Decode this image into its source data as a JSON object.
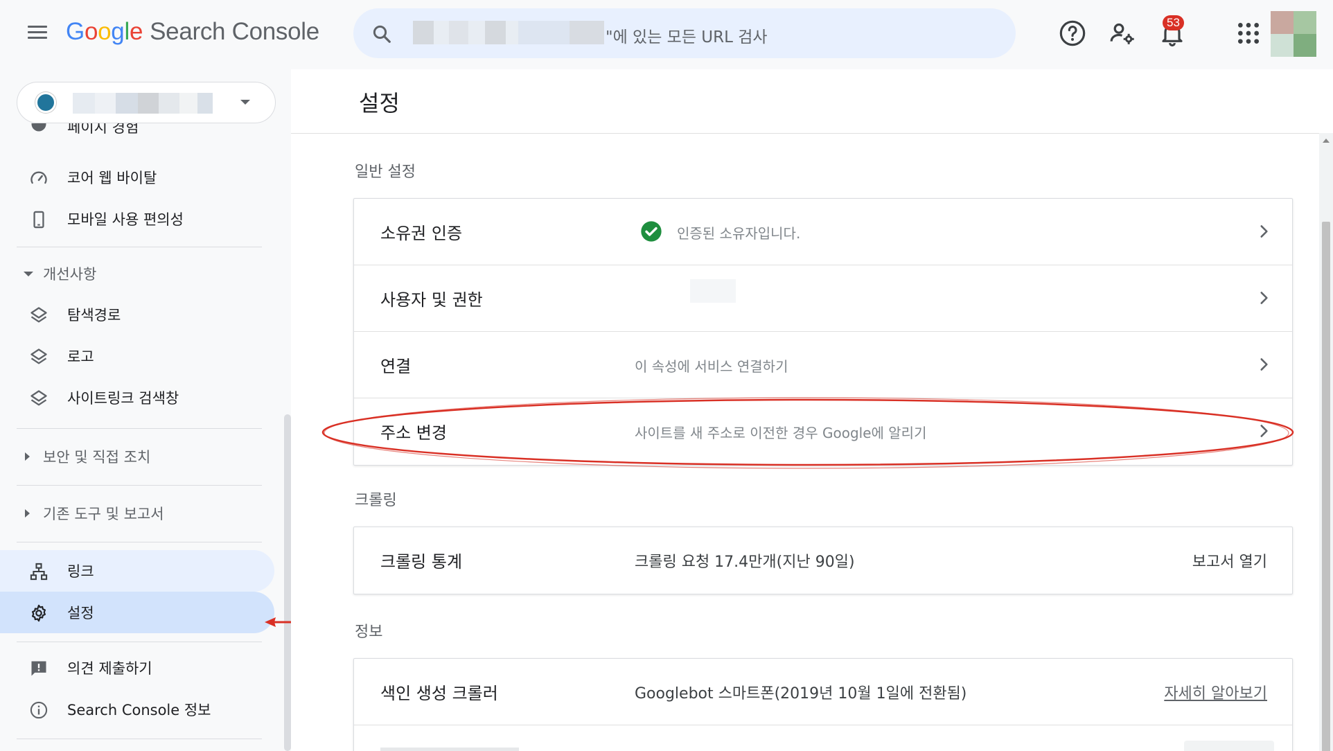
{
  "header": {
    "logo": {
      "g1": "G",
      "o1": "o",
      "o2": "o",
      "g2": "g",
      "l": "l",
      "e": "e",
      "product": "Search Console"
    },
    "search_text": "\"에 있는 모든 URL 검사",
    "notification_count": "53"
  },
  "sidebar": {
    "partial_item": "페이지 경험",
    "items": [
      {
        "label": "코어 웹 바이탈"
      },
      {
        "label": "모바일 사용 편의성"
      }
    ],
    "section_improvements": "개선사항",
    "improvements_items": [
      {
        "label": "탐색경로"
      },
      {
        "label": "로고"
      },
      {
        "label": "사이트링크 검색창"
      }
    ],
    "section_security": "보안 및 직접 조치",
    "section_legacy": "기존 도구 및 보고서",
    "links_label": "링크",
    "settings_label": "설정",
    "feedback_label": "의견 제출하기",
    "about_label": "Search Console 정보"
  },
  "main": {
    "page_title": "설정",
    "general": {
      "title": "일반 설정",
      "rows": [
        {
          "label": "소유권 인증",
          "value": "인증된 소유자입니다."
        },
        {
          "label": "사용자 및 권한",
          "value": ""
        },
        {
          "label": "연결",
          "value": "이 속성에 서비스 연결하기"
        },
        {
          "label": "주소 변경",
          "value": "사이트를 새 주소로 이전한 경우 Google에 알리기"
        }
      ]
    },
    "crawling": {
      "title": "크롤링",
      "row": {
        "label": "크롤링 통계",
        "value": "크롤링 요청 17.4만개(지난 90일)",
        "link": "보고서 열기"
      }
    },
    "info": {
      "title": "정보",
      "row": {
        "label": "색인 생성 크롤러",
        "value": "Googlebot 스마트폰(2019년 10월 1일에 전환됨)",
        "link": "자세히 알아보기"
      }
    }
  },
  "colors": {
    "accent_blue": "#1a73e8",
    "selected_bg": "#d2e3fc",
    "search_bg": "#e8f0fe",
    "verified_green": "#1e8e3e",
    "annotation_red": "#d93025"
  }
}
